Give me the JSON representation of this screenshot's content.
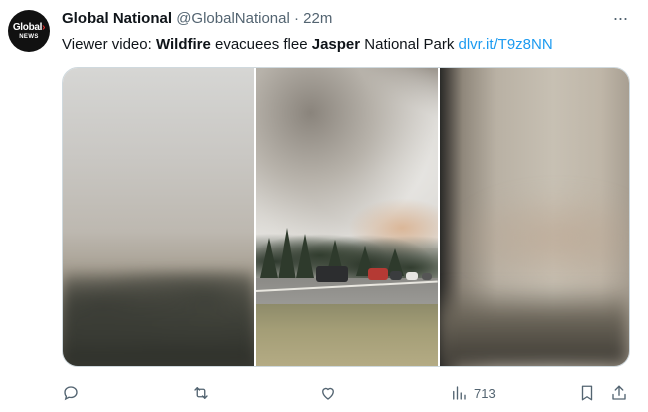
{
  "account": {
    "avatar_line1": "Global",
    "avatar_line2": "NEWS",
    "display_name": "Global National",
    "handle": "@GlobalNational",
    "separator": "·",
    "time": "22m"
  },
  "tweet": {
    "text_1": "Viewer video: ",
    "bold_1": "Wildfire",
    "text_2": " evacuees flee ",
    "bold_2": "Jasper",
    "text_3": " National Park ",
    "link": "dlvr.it/T9z8NN"
  },
  "actions": {
    "reply_icon": "reply-icon",
    "retweet_icon": "retweet-icon",
    "like_icon": "like-icon",
    "views_icon": "views-icon",
    "views_count": "713",
    "bookmark_icon": "bookmark-icon",
    "share_icon": "share-icon"
  },
  "colors": {
    "text": "#0f1419",
    "muted": "#536471",
    "link": "#1d9bf0",
    "border": "#cfd9de"
  }
}
